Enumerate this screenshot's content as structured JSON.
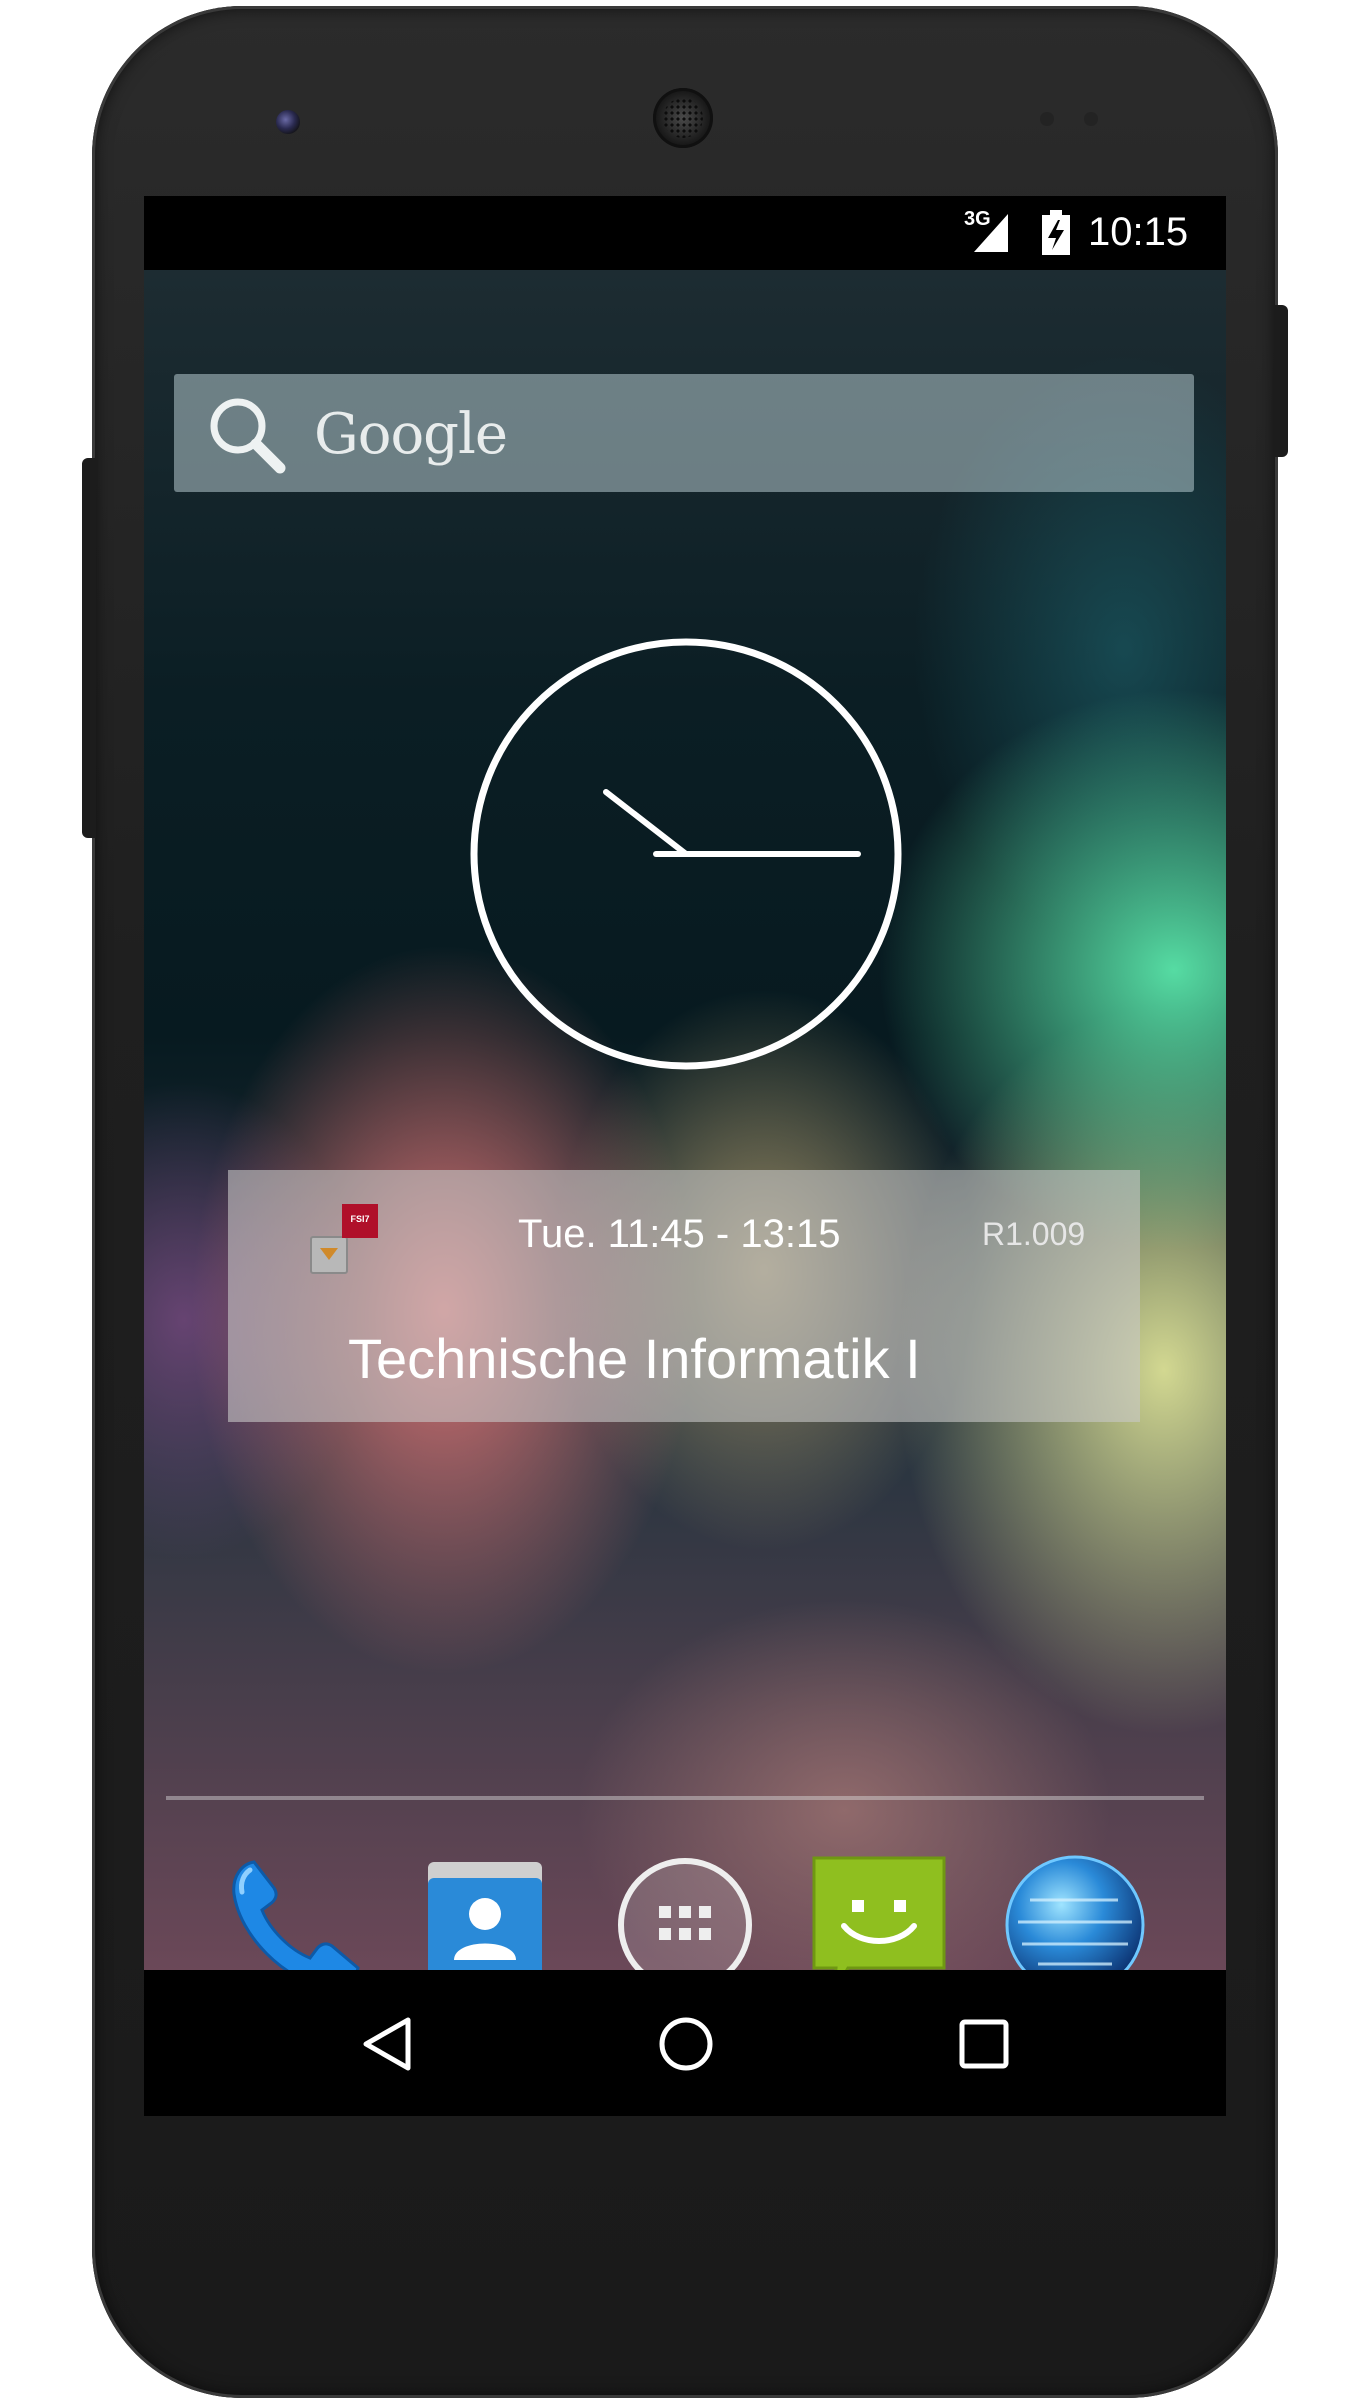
{
  "status_bar": {
    "network": "3G",
    "time": "10:15",
    "icons": [
      "signal-icon",
      "battery-charging-icon"
    ]
  },
  "search_widget": {
    "label": "Google",
    "icon": "search-icon"
  },
  "analog_clock": {
    "hour": 10,
    "minute": 15
  },
  "schedule_widget": {
    "app_icon": "schedule-app-icon",
    "app_badge": "FSI7",
    "time": "Tue. 11:45 - 13:15",
    "room": "R1.009",
    "course": "Technische Informatik I"
  },
  "dock": {
    "items": [
      {
        "name": "phone",
        "icon": "phone-icon"
      },
      {
        "name": "contacts",
        "icon": "contacts-icon"
      },
      {
        "name": "app-drawer",
        "icon": "app-drawer-icon"
      },
      {
        "name": "messaging",
        "icon": "messaging-icon"
      },
      {
        "name": "browser",
        "icon": "browser-globe-icon"
      }
    ]
  },
  "navigation_bar": {
    "buttons": [
      "back",
      "home",
      "recents"
    ]
  },
  "colors": {
    "status_bar_bg": "#000000",
    "phone_icon": "#1e88e5",
    "contacts_icon": "#2a8ad8",
    "messaging_icon": "#8fbf1f"
  }
}
